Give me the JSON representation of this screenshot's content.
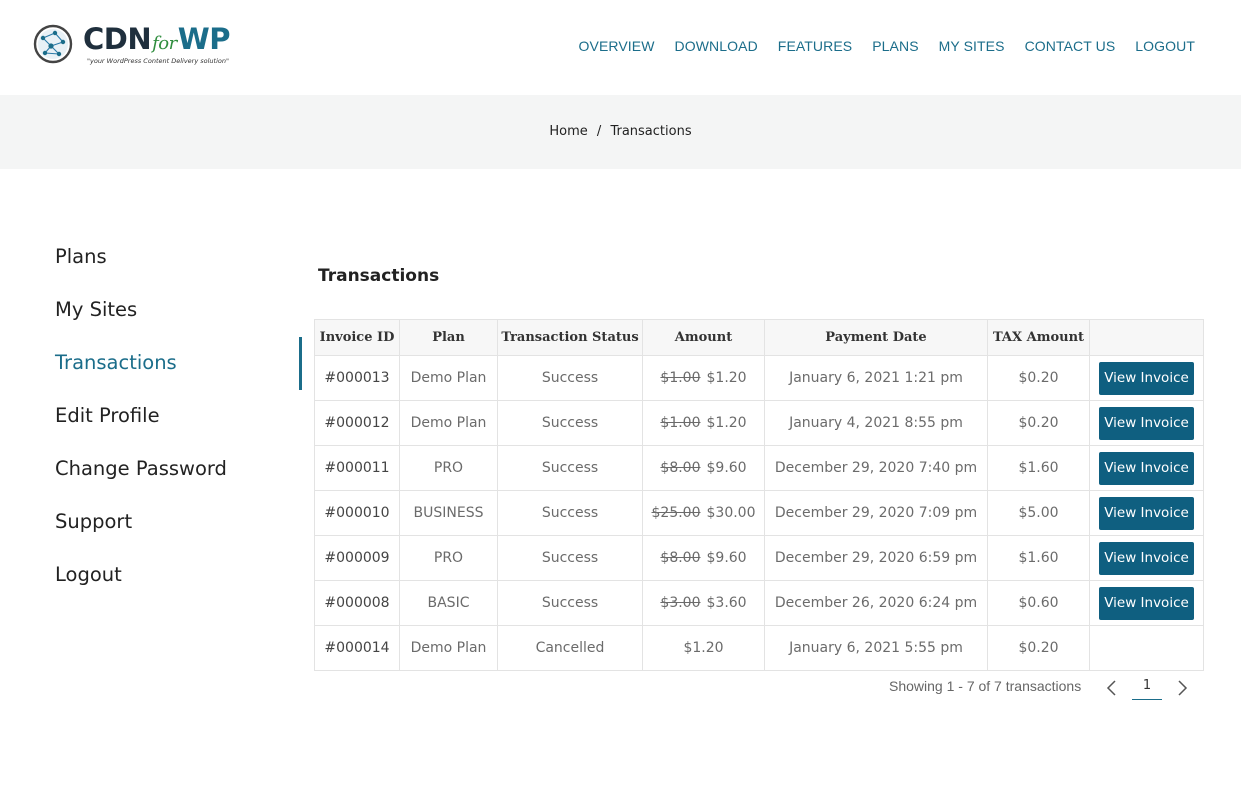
{
  "brand": {
    "name_cdn": "CDN",
    "name_for": "for",
    "name_wp": "WP",
    "tagline": "\"your WordPress Content Delivery solution\"",
    "accent_color": "#1b6d8a",
    "logo_icon": "globe-network-icon"
  },
  "nav": {
    "items": [
      "OVERVIEW",
      "DOWNLOAD",
      "FEATURES",
      "PLANS",
      "MY SITES",
      "CONTACT US",
      "LOGOUT"
    ]
  },
  "breadcrumb": {
    "home": "Home",
    "separator": "/",
    "current": "Transactions"
  },
  "sidebar": {
    "items": [
      "Plans",
      "My Sites",
      "Transactions",
      "Edit Profile",
      "Change Password",
      "Support",
      "Logout"
    ],
    "active_index": 2
  },
  "main": {
    "title": "Transactions",
    "columns": [
      "Invoice ID",
      "Plan",
      "Transaction Status",
      "Amount",
      "Payment Date",
      "TAX Amount",
      ""
    ],
    "button_label": "View Invoice",
    "rows": [
      {
        "id": "#000013",
        "plan": "Demo Plan",
        "status": "Success",
        "old": "$1.00",
        "amount": "$1.20",
        "date": "January 6, 2021 1:21 pm",
        "tax": "$0.20",
        "invoice": true
      },
      {
        "id": "#000012",
        "plan": "Demo Plan",
        "status": "Success",
        "old": "$1.00",
        "amount": "$1.20",
        "date": "January 4, 2021 8:55 pm",
        "tax": "$0.20",
        "invoice": true
      },
      {
        "id": "#000011",
        "plan": "PRO",
        "status": "Success",
        "old": "$8.00",
        "amount": "$9.60",
        "date": "December 29, 2020 7:40 pm",
        "tax": "$1.60",
        "invoice": true
      },
      {
        "id": "#000010",
        "plan": "BUSINESS",
        "status": "Success",
        "old": "$25.00",
        "amount": "$30.00",
        "date": "December 29, 2020 7:09 pm",
        "tax": "$5.00",
        "invoice": true
      },
      {
        "id": "#000009",
        "plan": "PRO",
        "status": "Success",
        "old": "$8.00",
        "amount": "$9.60",
        "date": "December 29, 2020 6:59 pm",
        "tax": "$1.60",
        "invoice": true
      },
      {
        "id": "#000008",
        "plan": "BASIC",
        "status": "Success",
        "old": "$3.00",
        "amount": "$3.60",
        "date": "December 26, 2020 6:24 pm",
        "tax": "$0.60",
        "invoice": true
      },
      {
        "id": "#000014",
        "plan": "Demo Plan",
        "status": "Cancelled",
        "old": "",
        "amount": "$1.20",
        "date": "January 6, 2021 5:55 pm",
        "tax": "$0.20",
        "invoice": false
      }
    ]
  },
  "pagination": {
    "summary": "Showing 1 - 7 of 7 transactions",
    "current_page": "1",
    "prev_icon": "chevron-left-icon",
    "next_icon": "chevron-right-icon"
  }
}
